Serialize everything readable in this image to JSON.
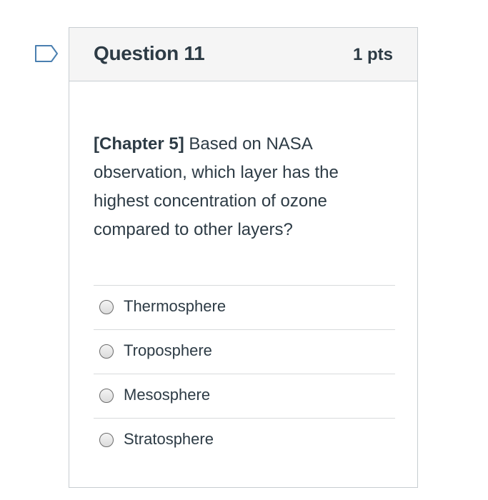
{
  "question": {
    "title": "Question 11",
    "points": "1 pts",
    "chapter_tag": "[Chapter 5]",
    "body": " Based on NASA observation, which layer has the highest concentration of ozone compared to other layers?"
  },
  "answers": [
    {
      "label": "Thermosphere",
      "selected": false
    },
    {
      "label": "Troposphere",
      "selected": false
    },
    {
      "label": "Mesosphere",
      "selected": false
    },
    {
      "label": "Stratosphere",
      "selected": false
    }
  ],
  "icons": {
    "flag": "flag-outline-icon"
  },
  "colors": {
    "text": "#2d3b45",
    "header_bg": "#f5f5f5",
    "border": "#c7cdd1",
    "flag_outline": "#4a7fb0"
  }
}
